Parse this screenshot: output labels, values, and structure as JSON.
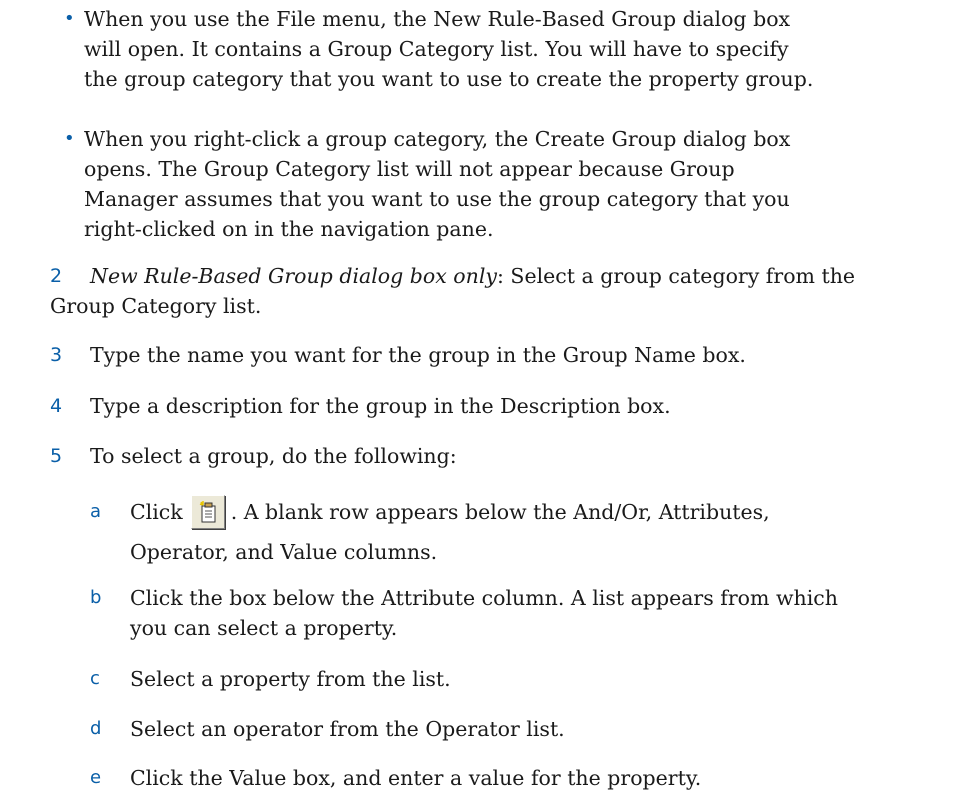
{
  "bullets": [
    {
      "lines": [
        "When you use the File menu, the New Rule-Based Group dialog box",
        "will open. It contains a Group Category list. You will have to specify",
        "the group category that you want to use to create the property group."
      ]
    },
    {
      "lines": [
        "When you right-click a group category, the Create Group dialog box",
        "opens. The Group Category list will not appear because Group",
        "Manager assumes that you want to use the group category that you",
        "right-clicked on in the navigation pane."
      ]
    }
  ],
  "bullet_symbol": "•",
  "steps": [
    {
      "number": "2",
      "emphasis": "New Rule-Based Group dialog box only",
      "line1_rest": ": Select a group category from the",
      "line2": "Group Category list."
    },
    {
      "number": "3",
      "text": "Type the name you want for the group in the Group Name box."
    },
    {
      "number": "4",
      "text": "Type a description for the group in the Description box."
    },
    {
      "number": "5",
      "text": "To select a group, do the following:"
    }
  ],
  "substeps": [
    {
      "letter": "a",
      "before_icon": "Click",
      "after_icon": ". A blank row appears below the And/Or, Attributes,",
      "line2": "Operator, and Value columns.",
      "icon": "new-row-icon"
    },
    {
      "letter": "b",
      "line1": "Click the box below the Attribute column. A list appears from which",
      "line2": "you can select a property."
    },
    {
      "letter": "c",
      "line1": "Select a property from the list."
    },
    {
      "letter": "d",
      "line1": "Select an operator from the Operator list."
    },
    {
      "letter": "e",
      "line1": "Click the Value box, and enter a value for the property."
    }
  ],
  "colors": {
    "marker_blue": "#0a5fa8",
    "text": "#1a1a1a",
    "button_face": "#ece9d8"
  }
}
